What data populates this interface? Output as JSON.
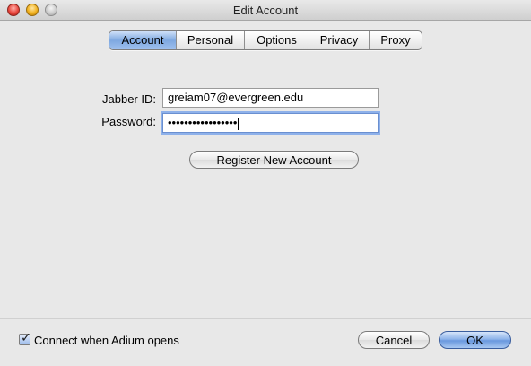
{
  "window": {
    "title": "Edit Account"
  },
  "tabs": [
    {
      "label": "Account",
      "active": true
    },
    {
      "label": "Personal",
      "active": false
    },
    {
      "label": "Options",
      "active": false
    },
    {
      "label": "Privacy",
      "active": false
    },
    {
      "label": "Proxy",
      "active": false
    }
  ],
  "form": {
    "jabber_id_label": "Jabber ID:",
    "jabber_id_value": "greiam07@evergreen.edu",
    "password_label": "Password:",
    "password_value": "•••••••••••••••••",
    "register_label": "Register New Account"
  },
  "footer": {
    "connect_label": "Connect when Adium opens",
    "connect_checked": true,
    "cancel_label": "Cancel",
    "ok_label": "OK"
  },
  "colors": {
    "accent": "#7ea8e0",
    "window_bg": "#e8e8e8"
  }
}
